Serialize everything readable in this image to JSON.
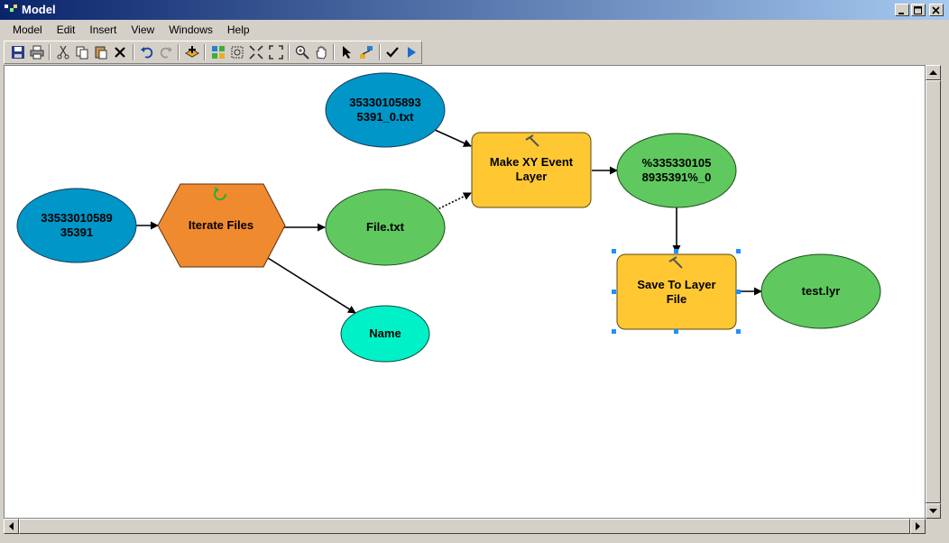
{
  "window": {
    "title": "Model"
  },
  "menu": [
    "Model",
    "Edit",
    "Insert",
    "View",
    "Windows",
    "Help"
  ],
  "toolbar": [
    {
      "icon": "save-icon"
    },
    {
      "icon": "print-icon"
    },
    {
      "sep": true
    },
    {
      "icon": "cut-icon"
    },
    {
      "icon": "copy-icon"
    },
    {
      "icon": "paste-icon"
    },
    {
      "icon": "delete-icon"
    },
    {
      "sep": true
    },
    {
      "icon": "undo-icon"
    },
    {
      "icon": "redo-icon"
    },
    {
      "sep": true
    },
    {
      "icon": "add-data-icon"
    },
    {
      "sep": true
    },
    {
      "icon": "auto-layout-icon"
    },
    {
      "icon": "full-extent-icon"
    },
    {
      "icon": "fit-to-window-icon"
    },
    {
      "icon": "zoom-extent-icon"
    },
    {
      "sep": true
    },
    {
      "icon": "zoom-in-icon"
    },
    {
      "icon": "pan-icon"
    },
    {
      "sep": true
    },
    {
      "icon": "select-icon"
    },
    {
      "icon": "connect-icon"
    },
    {
      "sep": true
    },
    {
      "icon": "validate-icon"
    },
    {
      "icon": "run-icon"
    }
  ],
  "nodes": {
    "input_file": "35330105893\n5391_0.txt",
    "folder": "33533010589\n35391",
    "iterate": "Iterate Files",
    "file_txt": "File.txt",
    "name": "Name",
    "make_xy": "Make XY Event\nLayer",
    "output_layer": "%335330105\n8935391%_0",
    "save_layer": "Save To Layer\nFile",
    "test_lyr": "test.lyr"
  },
  "colors": {
    "blue": "#0096c8",
    "green": "#5fc95f",
    "orange": "#f08a2f",
    "yellow": "#ffc832",
    "cyan": "#00f0c8"
  }
}
